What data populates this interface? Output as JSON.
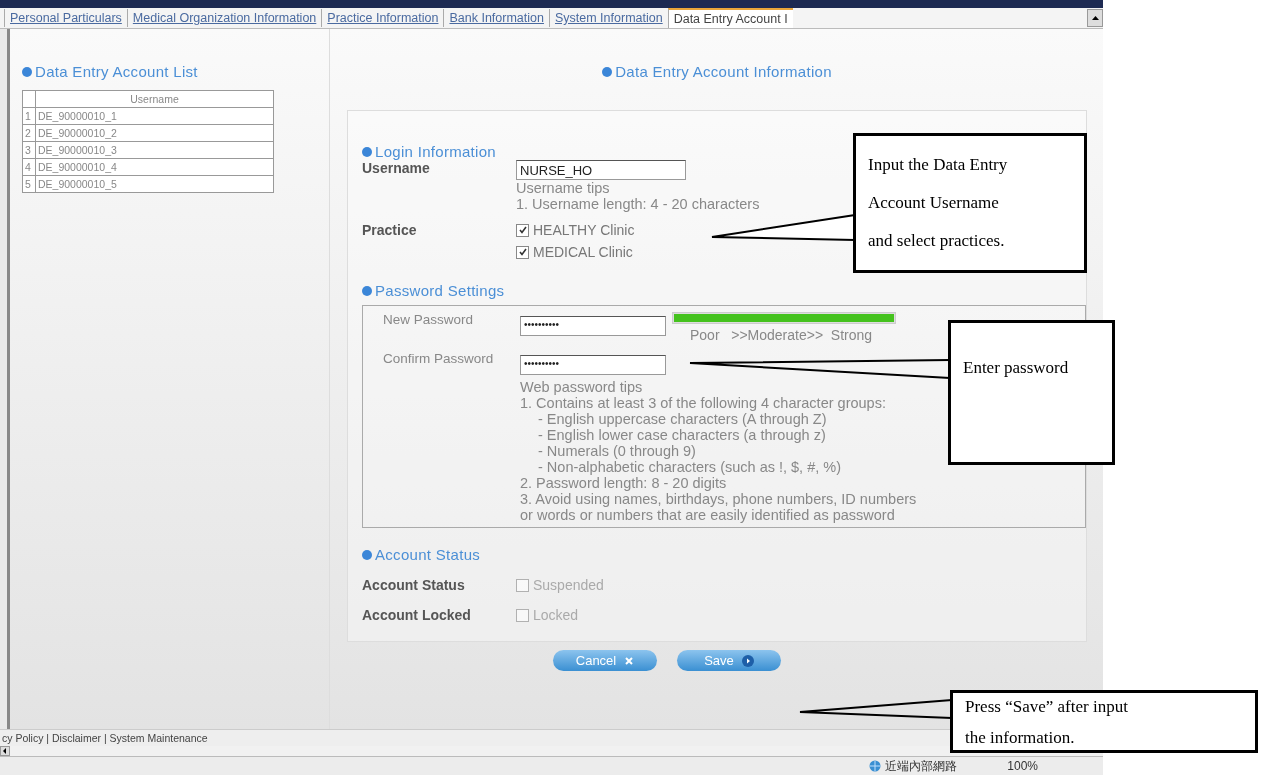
{
  "tabs": [
    {
      "label": "Personal Particulars",
      "selected": false
    },
    {
      "label": "Medical Organization Information",
      "selected": false
    },
    {
      "label": "Practice Information",
      "selected": false
    },
    {
      "label": "Bank Information",
      "selected": false
    },
    {
      "label": "System Information",
      "selected": false
    },
    {
      "label": "Data Entry Account I",
      "selected": true
    }
  ],
  "account_list": {
    "title": "Data Entry Account List",
    "column": "Username",
    "rows": [
      {
        "index": "1",
        "username": "DE_90000010_1"
      },
      {
        "index": "2",
        "username": "DE_90000010_2"
      },
      {
        "index": "3",
        "username": "DE_90000010_3"
      },
      {
        "index": "4",
        "username": "DE_90000010_4"
      },
      {
        "index": "5",
        "username": "DE_90000010_5"
      }
    ]
  },
  "account_info": {
    "title": "Data Entry Account Information",
    "login": {
      "heading": "Login Information",
      "username_label": "Username",
      "username_value": "NURSE_HO",
      "tips": [
        "Username tips",
        "1. Username length: 4 - 20 characters"
      ],
      "practice_label": "Practice",
      "practices": [
        {
          "label": "HEALTHY Clinic",
          "checked": true
        },
        {
          "label": "MEDICAL Clinic",
          "checked": true
        }
      ]
    },
    "password": {
      "heading": "Password Settings",
      "fields": [
        {
          "label": "New Password",
          "value": "••••••••••"
        },
        {
          "label": "Confirm Password",
          "value": "••••••••••"
        }
      ],
      "strength": {
        "level": 1,
        "text": "Poor   >>Moderate>>  Strong"
      },
      "tips": [
        {
          "text": "Web password tips"
        },
        {
          "text": "1. Contains at least 3 of the following 4 character groups:",
          "children": [
            {
              "text": "- English uppercase characters (A through Z)"
            },
            {
              "text": "- English lower case characters (a through z)"
            },
            {
              "text": "- Numerals (0 through 9)"
            },
            {
              "text": "- Non-alphabetic characters (such as !, $, #, %)"
            }
          ]
        },
        {
          "text": "2. Password length: 8 - 20 digits"
        },
        {
          "text": "3. Avoid using names, birthdays, phone numbers, ID numbers"
        },
        {
          "text": "or words or numbers that are easily identified as password"
        }
      ]
    },
    "status": {
      "heading": "Account Status",
      "rows": [
        {
          "label": "Account Status",
          "option": "Suspended",
          "checked": false,
          "disabled": true
        },
        {
          "label": "Account Locked",
          "option": "Locked",
          "checked": false,
          "disabled": true
        }
      ]
    },
    "buttons": [
      {
        "label": "Cancel",
        "kind": "cancel"
      },
      {
        "label": "Save",
        "kind": "save"
      }
    ]
  },
  "footer": "cy Policy | Disclaimer | System Maintenance",
  "status_bar": {
    "zone": "近端內部網路",
    "zoom": "100%"
  },
  "callouts": [
    {
      "lines": [
        "Input the Data Entry",
        "Account Username",
        "and select practices."
      ]
    },
    {
      "lines": [
        "Enter password"
      ]
    },
    {
      "lines": [
        "Press “Save” after input",
        "the information."
      ]
    }
  ]
}
